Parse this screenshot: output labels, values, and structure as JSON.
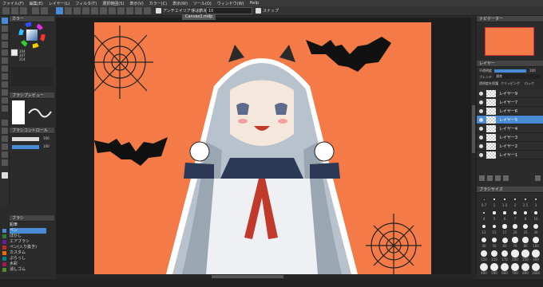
{
  "menu": [
    "ファイル(F)",
    "編集(E)",
    "レイヤー(L)",
    "フィルタ(T)",
    "選択範囲(S)",
    "表示(V)",
    "カラー(C)",
    "表示(W)",
    "ツール(O)",
    "ウィンドウ(W)",
    "Help"
  ],
  "toolbar": {
    "antialias_label": "アンチエイリアシング",
    "correction_label": "手ぶれ補正",
    "correction_value": "10",
    "snap_label": "スナップ"
  },
  "doc_tab": "Canvas1.mdp",
  "panels": {
    "color_title": "カラー",
    "color_values": [
      "204",
      "207",
      "214"
    ],
    "brush_preview_title": "ブラシプレビュー",
    "brush_control_title": "ブラシコントロール",
    "brush_size_value": "100",
    "brush_opacity_value": "100",
    "brush_title": "ブラシ",
    "navigator_title": "ナビゲーター",
    "layer_title": "レイヤー",
    "layer_opacity_label": "不透明度",
    "layer_opacity_value": "100",
    "blend_label": "ブレンド",
    "blend_value": "通常",
    "clipping_label": "クリッピング",
    "protect_label": "透明度を保護",
    "lock_label": "ロック",
    "brushsize_title": "ブラシサイズ"
  },
  "brush_list": [
    {
      "label": "鉛筆",
      "color": "#3b78c4"
    },
    {
      "label": "ペン",
      "color": "#4a8bd6",
      "active": true
    },
    {
      "label": "ぼかし",
      "color": "#2e7d32"
    },
    {
      "label": "エアブラシ",
      "color": "#6a1b9a"
    },
    {
      "label": "ペン(入り抜き)",
      "color": "#c62828"
    },
    {
      "label": "カスタム",
      "color": "#ef6c00"
    },
    {
      "label": "ぷらっし",
      "color": "#00838f"
    },
    {
      "label": "水彩",
      "color": "#ad1457"
    },
    {
      "label": "消しゴム",
      "color": "#558b2f"
    }
  ],
  "layers": [
    {
      "label": "レイヤー9",
      "active": false
    },
    {
      "label": "レイヤー7",
      "active": false
    },
    {
      "label": "レイヤー6",
      "active": false
    },
    {
      "label": "レイヤー5",
      "active": true
    },
    {
      "label": "レイヤー4",
      "active": false
    },
    {
      "label": "レイヤー3",
      "active": false
    },
    {
      "label": "レイヤー2",
      "active": false
    },
    {
      "label": "レイヤー1",
      "active": false
    }
  ],
  "brush_sizes": [
    "0.7",
    "1",
    "1.5",
    "2",
    "2.5",
    "3",
    "4",
    "5",
    "6",
    "7",
    "8",
    "10",
    "12",
    "15",
    "17",
    "20",
    "25",
    "30",
    "40",
    "50",
    "60",
    "70",
    "80",
    "100",
    "120",
    "150",
    "170",
    "200",
    "250",
    "300",
    "400",
    "500",
    "600",
    "700",
    "800",
    "1000"
  ],
  "colors": {
    "accent": "#4a8bd6",
    "canvas_bg": "#f47b48",
    "panel": "#2b2b2b"
  }
}
